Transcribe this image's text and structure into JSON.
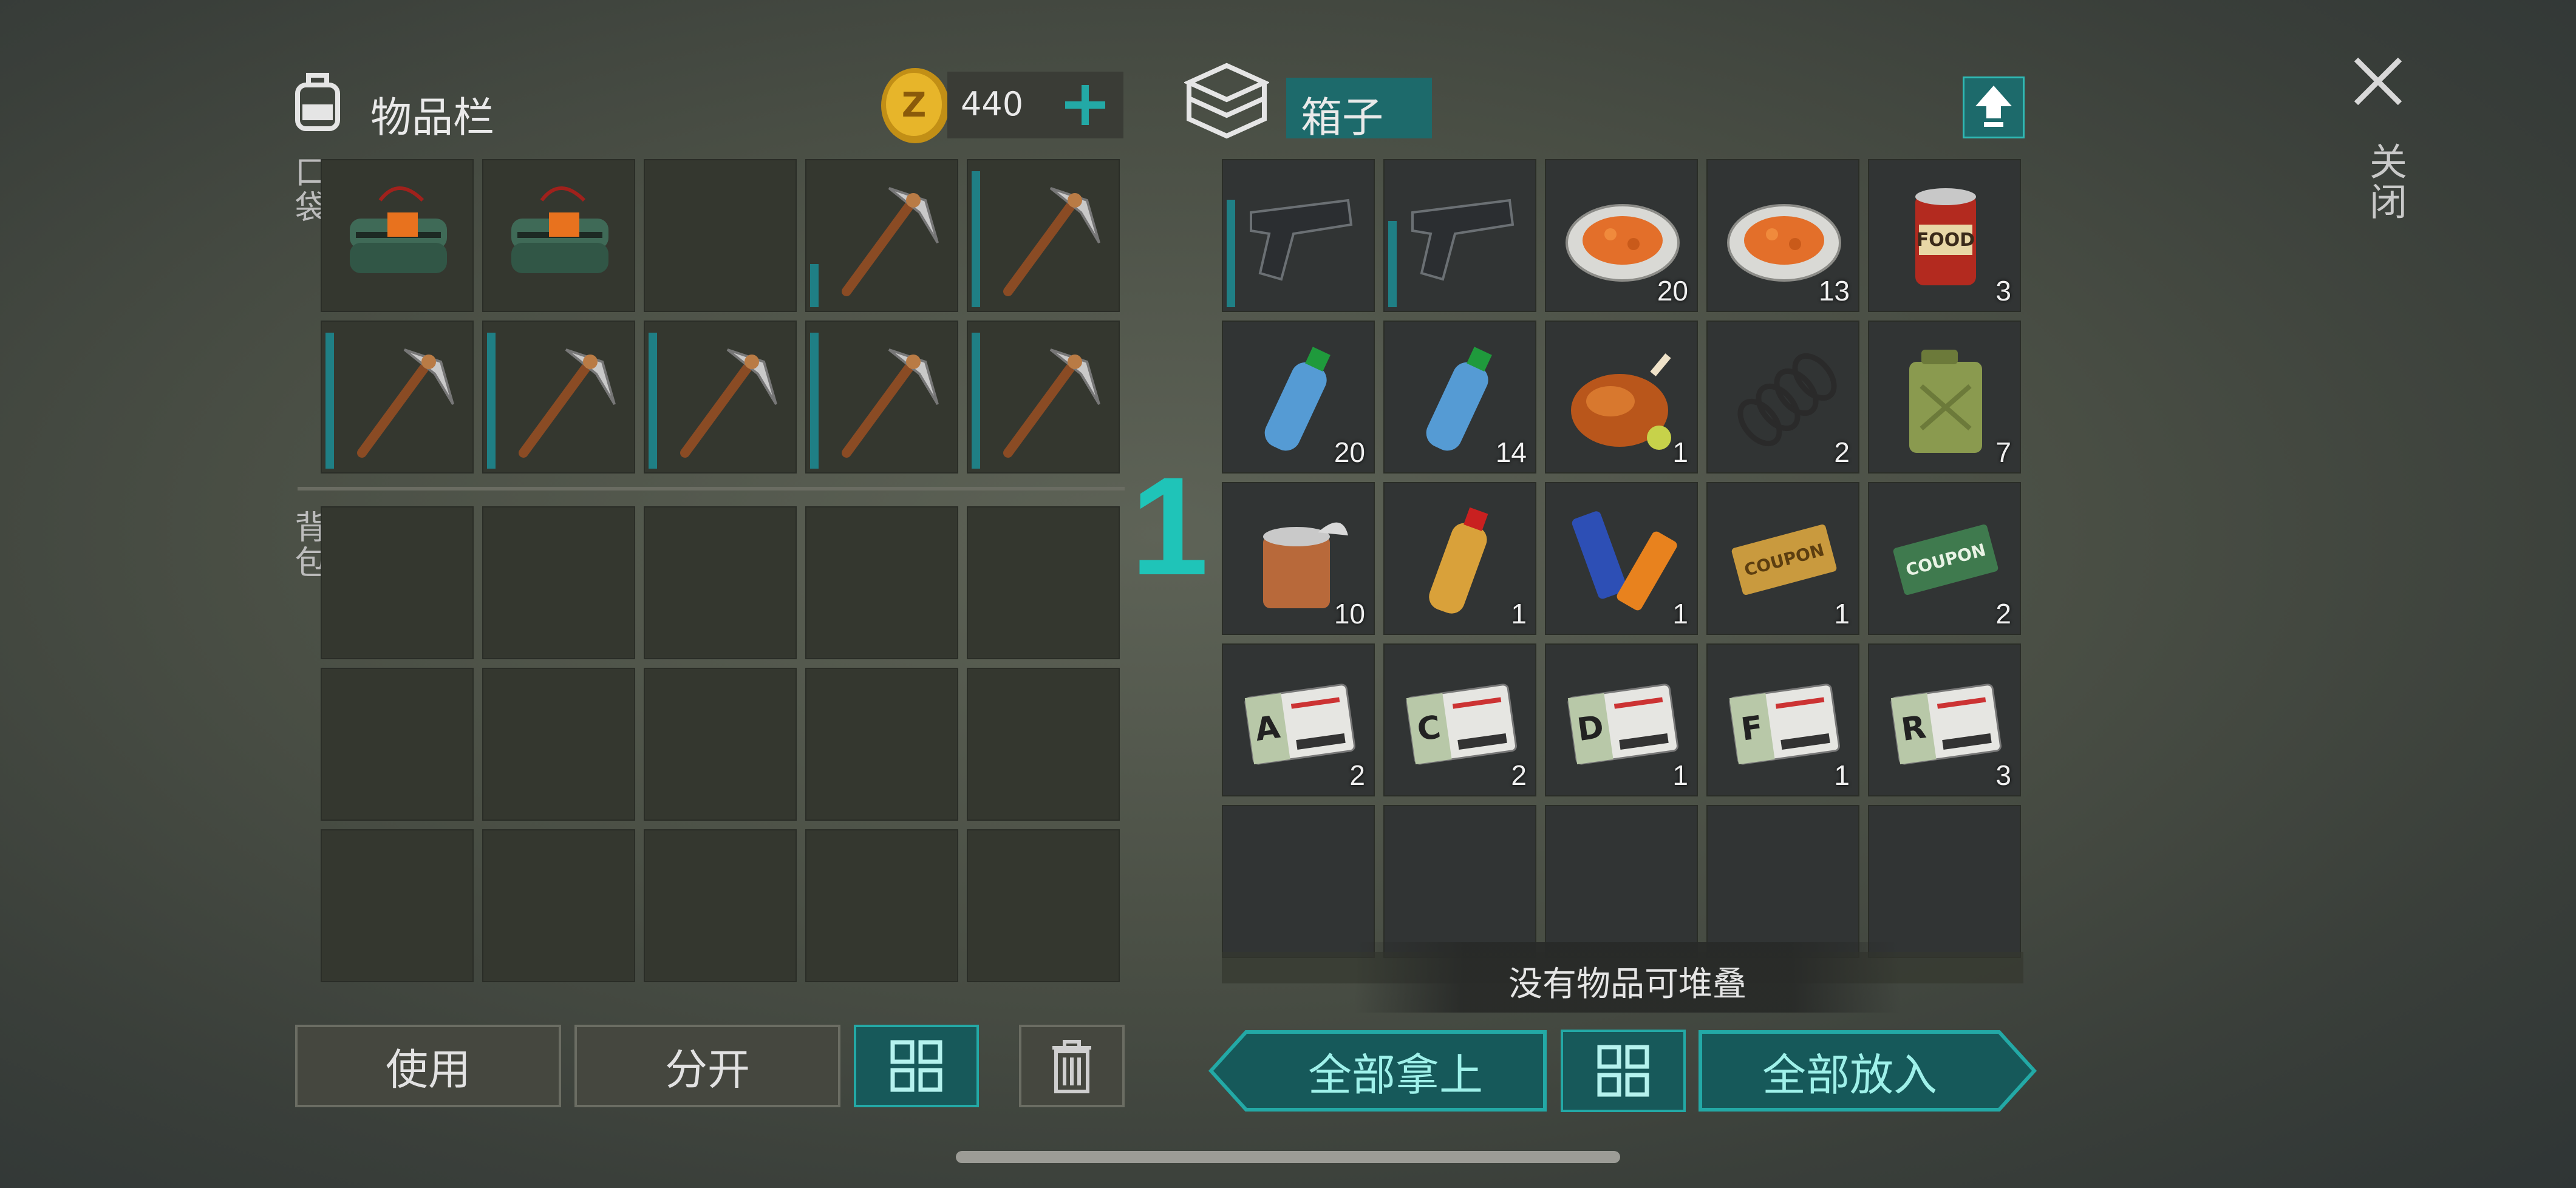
{
  "left_panel": {
    "title": "物品栏",
    "coins": "440",
    "pocket_label": "口袋",
    "backpack_label": "背包",
    "pocket_items": [
      {
        "icon": "explosive-bundle-icon"
      },
      {
        "icon": "explosive-bundle-icon"
      },
      {
        "icon": ""
      },
      {
        "icon": "pickaxe-icon",
        "durability": 0.3
      },
      {
        "icon": "pickaxe-icon",
        "durability": 0.95
      },
      {
        "icon": "pickaxe-icon",
        "durability": 0.95
      },
      {
        "icon": "pickaxe-icon",
        "durability": 0.95
      },
      {
        "icon": "pickaxe-icon",
        "durability": 0.95
      },
      {
        "icon": "pickaxe-icon",
        "durability": 0.95
      },
      {
        "icon": "pickaxe-icon",
        "durability": 0.95
      }
    ],
    "buttons": {
      "use": "使用",
      "split": "分开"
    }
  },
  "center_label": "1",
  "right_panel": {
    "title": "箱子",
    "items": [
      {
        "icon": "pistol-icon",
        "count": "",
        "durability": 0.75
      },
      {
        "icon": "pistol-icon",
        "count": "",
        "durability": 0.6
      },
      {
        "icon": "food-plate-icon",
        "count": "20"
      },
      {
        "icon": "food-plate-icon",
        "count": "13"
      },
      {
        "icon": "canned-food-icon",
        "count": "3"
      },
      {
        "icon": "water-bottle-icon",
        "count": "20"
      },
      {
        "icon": "water-bottle-icon",
        "count": "14"
      },
      {
        "icon": "roast-chicken-icon",
        "count": "1"
      },
      {
        "icon": "spring-icon",
        "count": "2"
      },
      {
        "icon": "jerrycan-icon",
        "count": "7"
      },
      {
        "icon": "open-can-icon",
        "count": "10"
      },
      {
        "icon": "juice-bottle-icon",
        "count": "1"
      },
      {
        "icon": "batteries-icon",
        "count": "1"
      },
      {
        "icon": "survival-coupon-icon",
        "count": "1"
      },
      {
        "icon": "ration-coupon-icon",
        "count": "2"
      },
      {
        "icon": "us-army-card-a-icon",
        "count": "2",
        "letter": "A"
      },
      {
        "icon": "us-army-card-c-icon",
        "count": "2",
        "letter": "C"
      },
      {
        "icon": "us-army-card-d-icon",
        "count": "1",
        "letter": "D"
      },
      {
        "icon": "us-army-card-f-icon",
        "count": "1",
        "letter": "F"
      },
      {
        "icon": "us-army-card-r-icon",
        "count": "3",
        "letter": "R"
      }
    ],
    "message": "没有物品可堆叠",
    "buttons": {
      "take_all": "全部拿上",
      "put_all": "全部放入"
    }
  },
  "close": {
    "label": "关闭"
  },
  "colors": {
    "accent": "#23a9a6",
    "coin": "#e7b52a"
  }
}
